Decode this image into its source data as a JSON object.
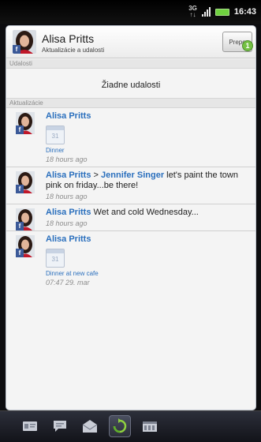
{
  "status_bar": {
    "time": "16:43",
    "network": "3G"
  },
  "header": {
    "name": "Alisa Pritts",
    "subtitle": "Aktualizácie a udalosti",
    "button_label": "Prepo",
    "badge_count": "1"
  },
  "events": {
    "section_label": "Udalosti",
    "empty_text": "Žiadne udalosti"
  },
  "updates": {
    "section_label": "Aktualizácie",
    "items": [
      {
        "name": "Alisa Pritts",
        "link_text": "Dinner",
        "time": "18 hours ago",
        "calendar_num": "31"
      },
      {
        "name": "Alisa Pritts",
        "separator": ">",
        "target": "Jennifer Singer",
        "text": "let's paint the town pink on friday...be there!",
        "time": "18 hours ago"
      },
      {
        "name": "Alisa Pritts",
        "text": "Wet and cold Wednesday...",
        "time": "18 hours ago"
      },
      {
        "name": "Alisa Pritts",
        "link_text": "Dinner at new cafe",
        "time": "07:47 29. mar",
        "calendar_num": "31"
      }
    ]
  },
  "bottom_nav": {
    "items": [
      "contacts-card-icon",
      "messages-icon",
      "email-icon",
      "updates-refresh-icon",
      "gallery-icon"
    ],
    "active_index": 3
  }
}
